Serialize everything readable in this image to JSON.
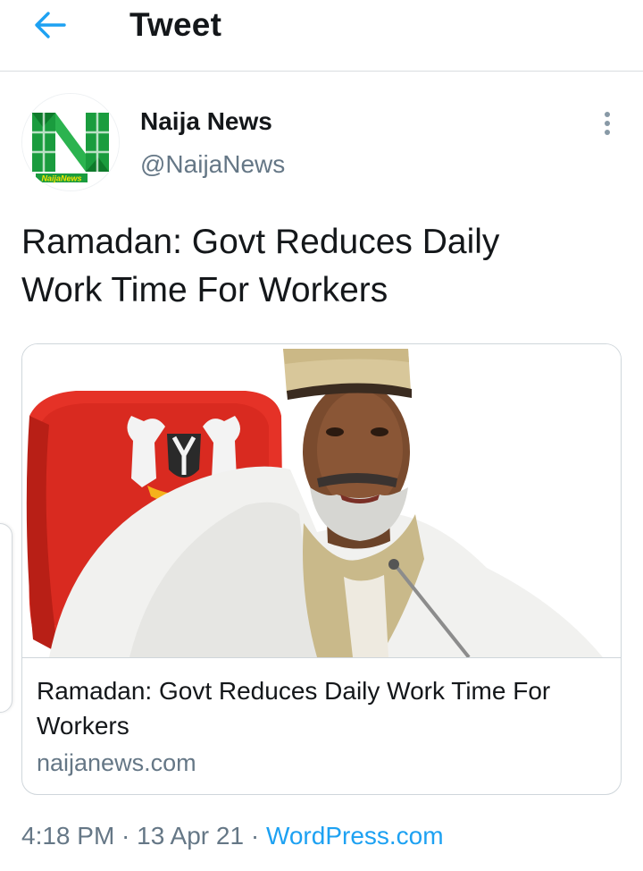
{
  "header": {
    "title": "Tweet",
    "back_icon": "arrow-left-icon"
  },
  "author": {
    "name": "Naija News",
    "handle": "@NaijaNews",
    "avatar_icon": "naija-news-logo",
    "avatar_caption": "NaijaNews"
  },
  "more_icon": "vertical-dots-icon",
  "tweet": {
    "text_line1": "Ramadan: Govt Reduces Daily",
    "text_line2": "Work Time For Workers"
  },
  "card": {
    "image_description": "photo",
    "title_line1": "Ramadan: Govt Reduces Daily Work Time For",
    "title_line2": "Workers",
    "domain": "naijanews.com"
  },
  "meta": {
    "time": "4:18 PM",
    "separator1": " · ",
    "date": "13 Apr 21",
    "separator2": " · ",
    "source": "WordPress.com"
  },
  "colors": {
    "accent": "#1da1f2",
    "secondary_text": "#657786",
    "primary_text": "#14171a",
    "brand_green": "#1a9c3e"
  }
}
